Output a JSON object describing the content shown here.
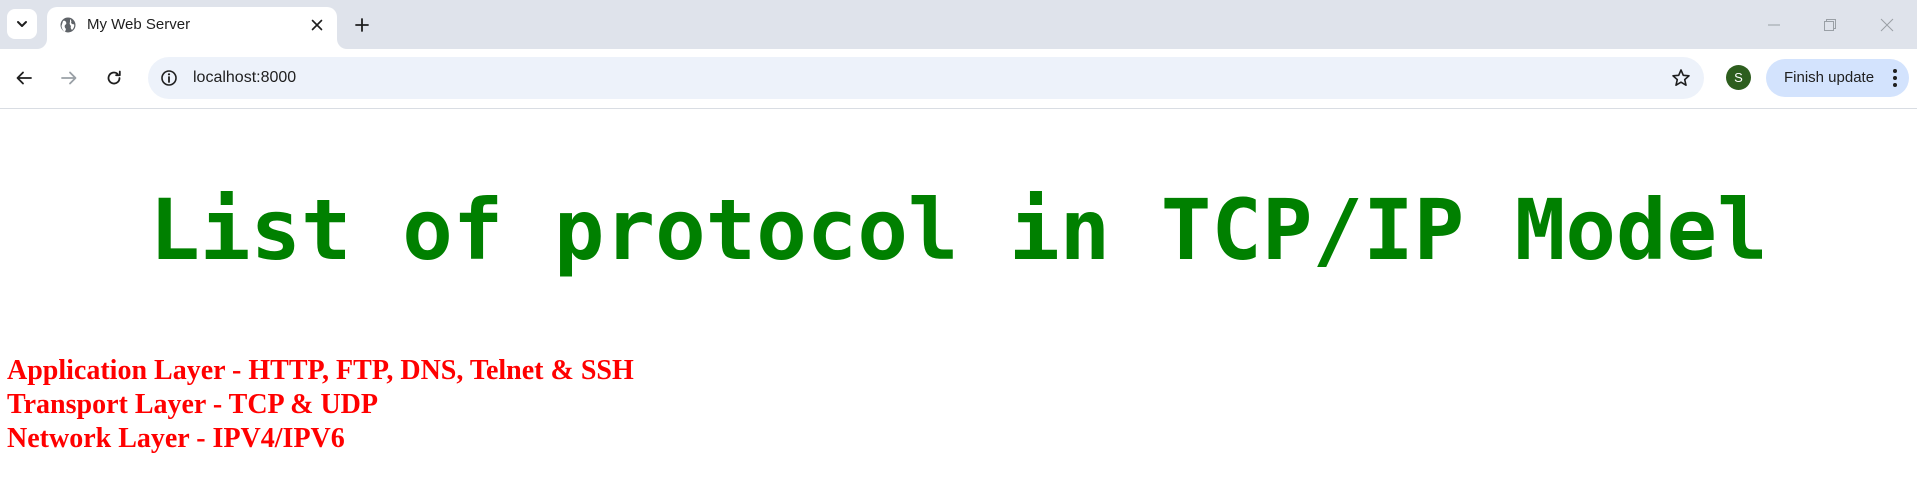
{
  "browser": {
    "tab": {
      "title": "My Web Server",
      "favicon": "globe-icon"
    },
    "address_bar": {
      "url": "localhost:8000"
    },
    "profile": {
      "initial": "S",
      "color": "#2d5e1e"
    },
    "update_button": {
      "label": "Finish update"
    }
  },
  "page": {
    "heading": "List of protocol in TCP/IP Model",
    "heading_color": "#008000",
    "layers": [
      "Application Layer - HTTP, FTP, DNS, Telnet & SSH",
      "Transport Layer - TCP & UDP",
      "Network Layer - IPV4/IPV6"
    ],
    "layers_color": "#ff0000"
  }
}
